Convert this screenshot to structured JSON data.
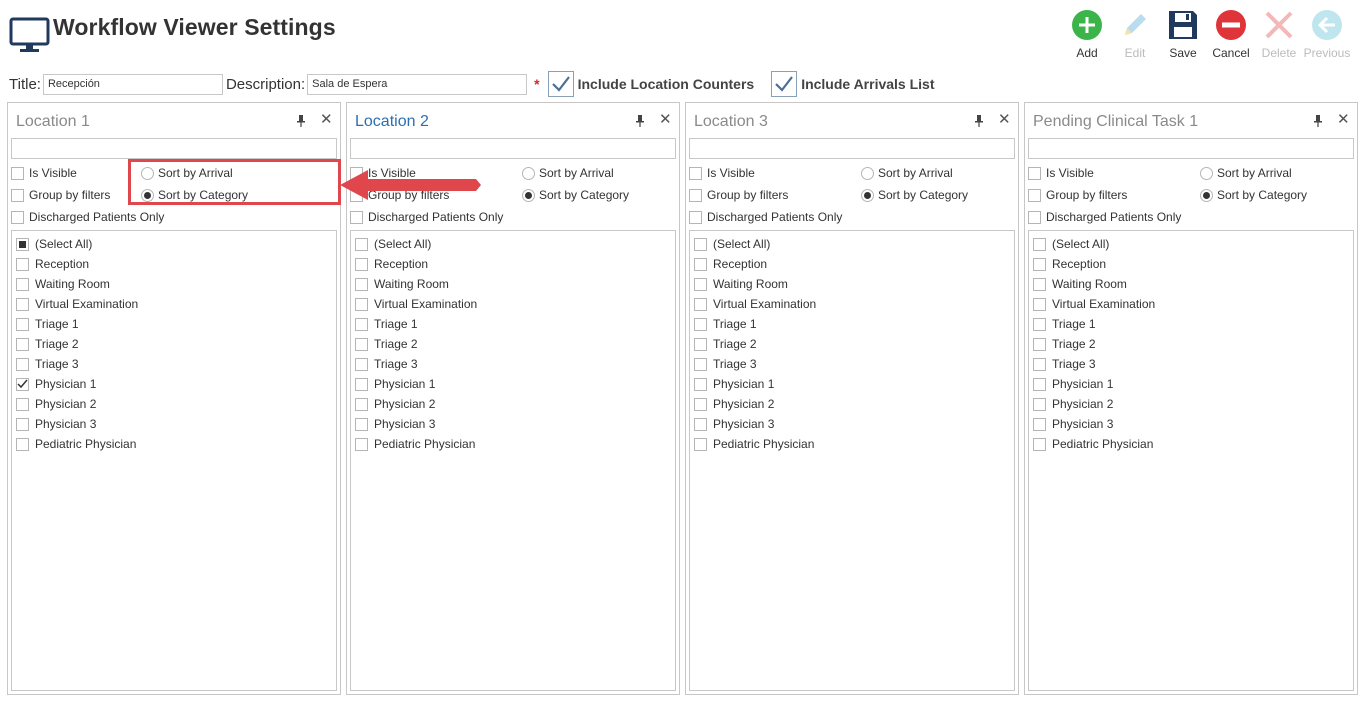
{
  "app": {
    "title": "Workflow Viewer Settings",
    "icon": "monitor-icon"
  },
  "toolbar": {
    "buttons": [
      {
        "label": "Add",
        "icon": "add-icon",
        "enabled": true,
        "color": "#3bb54a"
      },
      {
        "label": "Edit",
        "icon": "pencil-icon",
        "enabled": false,
        "color": "#b9dcef"
      },
      {
        "label": "Save",
        "icon": "save-icon",
        "enabled": true,
        "color": "#1f3a5c"
      },
      {
        "label": "Cancel",
        "icon": "cancel-icon",
        "enabled": true,
        "color": "#e0343b"
      },
      {
        "label": "Delete",
        "icon": "delete-icon",
        "enabled": false,
        "color": "#f3b8b8"
      },
      {
        "label": "Previous",
        "icon": "previous-icon",
        "enabled": false,
        "color": "#bfe6ef"
      }
    ]
  },
  "form": {
    "title_label": "Title:",
    "title_value": "Recepción",
    "description_label": "Description:",
    "description_value": "Sala de Espera",
    "required_marker": "*",
    "include_location_counters": {
      "label": "Include Location Counters",
      "checked": true
    },
    "include_arrivals_list": {
      "label": "Include Arrivals List",
      "checked": true
    }
  },
  "panels": [
    {
      "header": "Location 1",
      "active": false,
      "filter": "",
      "is_visible": {
        "label": "Is Visible",
        "checked": false
      },
      "group_by_filters": {
        "label": "Group by filters",
        "checked": false
      },
      "discharged_only": {
        "label": "Discharged Patients Only",
        "checked": false
      },
      "sort_by_arrival": {
        "label": "Sort by Arrival",
        "selected": false
      },
      "sort_by_category": {
        "label": "Sort by Category",
        "selected": true
      },
      "items": [
        {
          "label": "(Select All)",
          "state": "partial"
        },
        {
          "label": "Reception",
          "state": "unchecked"
        },
        {
          "label": "Waiting Room",
          "state": "unchecked"
        },
        {
          "label": "Virtual Examination",
          "state": "unchecked"
        },
        {
          "label": "Triage 1",
          "state": "unchecked"
        },
        {
          "label": "Triage 2",
          "state": "unchecked"
        },
        {
          "label": "Triage 3",
          "state": "unchecked"
        },
        {
          "label": "Physician 1",
          "state": "checked"
        },
        {
          "label": "Physician 2",
          "state": "unchecked"
        },
        {
          "label": "Physician 3",
          "state": "unchecked"
        },
        {
          "label": "Pediatric Physician",
          "state": "unchecked"
        }
      ]
    },
    {
      "header": "Location 2",
      "active": true,
      "filter": "",
      "is_visible": {
        "label": "Is Visible",
        "checked": false
      },
      "group_by_filters": {
        "label": "Group by filters",
        "checked": false
      },
      "discharged_only": {
        "label": "Discharged Patients Only",
        "checked": false
      },
      "sort_by_arrival": {
        "label": "Sort by Arrival",
        "selected": false
      },
      "sort_by_category": {
        "label": "Sort by Category",
        "selected": true
      },
      "items": [
        {
          "label": "(Select All)",
          "state": "unchecked"
        },
        {
          "label": "Reception",
          "state": "unchecked"
        },
        {
          "label": "Waiting Room",
          "state": "unchecked"
        },
        {
          "label": "Virtual Examination",
          "state": "unchecked"
        },
        {
          "label": "Triage 1",
          "state": "unchecked"
        },
        {
          "label": "Triage 2",
          "state": "unchecked"
        },
        {
          "label": "Triage 3",
          "state": "unchecked"
        },
        {
          "label": "Physician 1",
          "state": "unchecked"
        },
        {
          "label": "Physician 2",
          "state": "unchecked"
        },
        {
          "label": "Physician 3",
          "state": "unchecked"
        },
        {
          "label": "Pediatric Physician",
          "state": "unchecked"
        }
      ]
    },
    {
      "header": "Location 3",
      "active": false,
      "filter": "",
      "is_visible": {
        "label": "Is Visible",
        "checked": false
      },
      "group_by_filters": {
        "label": "Group by filters",
        "checked": false
      },
      "discharged_only": {
        "label": "Discharged Patients Only",
        "checked": false
      },
      "sort_by_arrival": {
        "label": "Sort by Arrival",
        "selected": false
      },
      "sort_by_category": {
        "label": "Sort by Category",
        "selected": true
      },
      "items": [
        {
          "label": "(Select All)",
          "state": "unchecked"
        },
        {
          "label": "Reception",
          "state": "unchecked"
        },
        {
          "label": "Waiting Room",
          "state": "unchecked"
        },
        {
          "label": "Virtual Examination",
          "state": "unchecked"
        },
        {
          "label": "Triage 1",
          "state": "unchecked"
        },
        {
          "label": "Triage 2",
          "state": "unchecked"
        },
        {
          "label": "Triage 3",
          "state": "unchecked"
        },
        {
          "label": "Physician 1",
          "state": "unchecked"
        },
        {
          "label": "Physician 2",
          "state": "unchecked"
        },
        {
          "label": "Physician 3",
          "state": "unchecked"
        },
        {
          "label": "Pediatric Physician",
          "state": "unchecked"
        }
      ]
    },
    {
      "header": "Pending Clinical Task 1",
      "active": false,
      "filter": "",
      "is_visible": {
        "label": "Is Visible",
        "checked": false
      },
      "group_by_filters": {
        "label": "Group by filters",
        "checked": false
      },
      "discharged_only": {
        "label": "Discharged Patients Only",
        "checked": false
      },
      "sort_by_arrival": {
        "label": "Sort by Arrival",
        "selected": false
      },
      "sort_by_category": {
        "label": "Sort by Category",
        "selected": true
      },
      "items": [
        {
          "label": "(Select All)",
          "state": "unchecked"
        },
        {
          "label": "Reception",
          "state": "unchecked"
        },
        {
          "label": "Waiting Room",
          "state": "unchecked"
        },
        {
          "label": "Virtual Examination",
          "state": "unchecked"
        },
        {
          "label": "Triage 1",
          "state": "unchecked"
        },
        {
          "label": "Triage 2",
          "state": "unchecked"
        },
        {
          "label": "Triage 3",
          "state": "unchecked"
        },
        {
          "label": "Physician 1",
          "state": "unchecked"
        },
        {
          "label": "Physician 2",
          "state": "unchecked"
        },
        {
          "label": "Physician 3",
          "state": "unchecked"
        },
        {
          "label": "Pediatric Physician",
          "state": "unchecked"
        }
      ]
    }
  ],
  "annotation": {
    "color": "#e0474c"
  }
}
